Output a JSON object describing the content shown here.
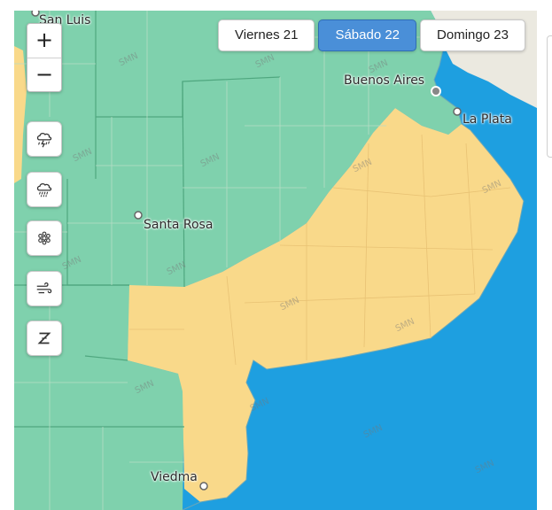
{
  "zoom": {
    "in_label": "+",
    "out_label": "−"
  },
  "day_tabs": [
    {
      "label": "Viernes 21",
      "active": false
    },
    {
      "label": "Sábado 22",
      "active": true
    },
    {
      "label": "Domingo 23",
      "active": false
    }
  ],
  "layer_buttons": [
    {
      "icon": "storm-icon"
    },
    {
      "icon": "rain-icon"
    },
    {
      "icon": "snow-icon"
    },
    {
      "icon": "wind-icon"
    },
    {
      "icon": "zonda-icon"
    }
  ],
  "cities": {
    "san_luis": "San Luis",
    "buenos_aires": "Buenos Aires",
    "la_plata": "La Plata",
    "santa_rosa": "Santa Rosa",
    "viedma": "Viedma"
  },
  "watermark": "SMN",
  "colors": {
    "no_alert": "#7fd1ad",
    "yellow_alert": "#f9d98a",
    "sea": "#1e9fe0",
    "land_outside": "#ebe9e0",
    "active_tab": "#4a8fd8"
  }
}
